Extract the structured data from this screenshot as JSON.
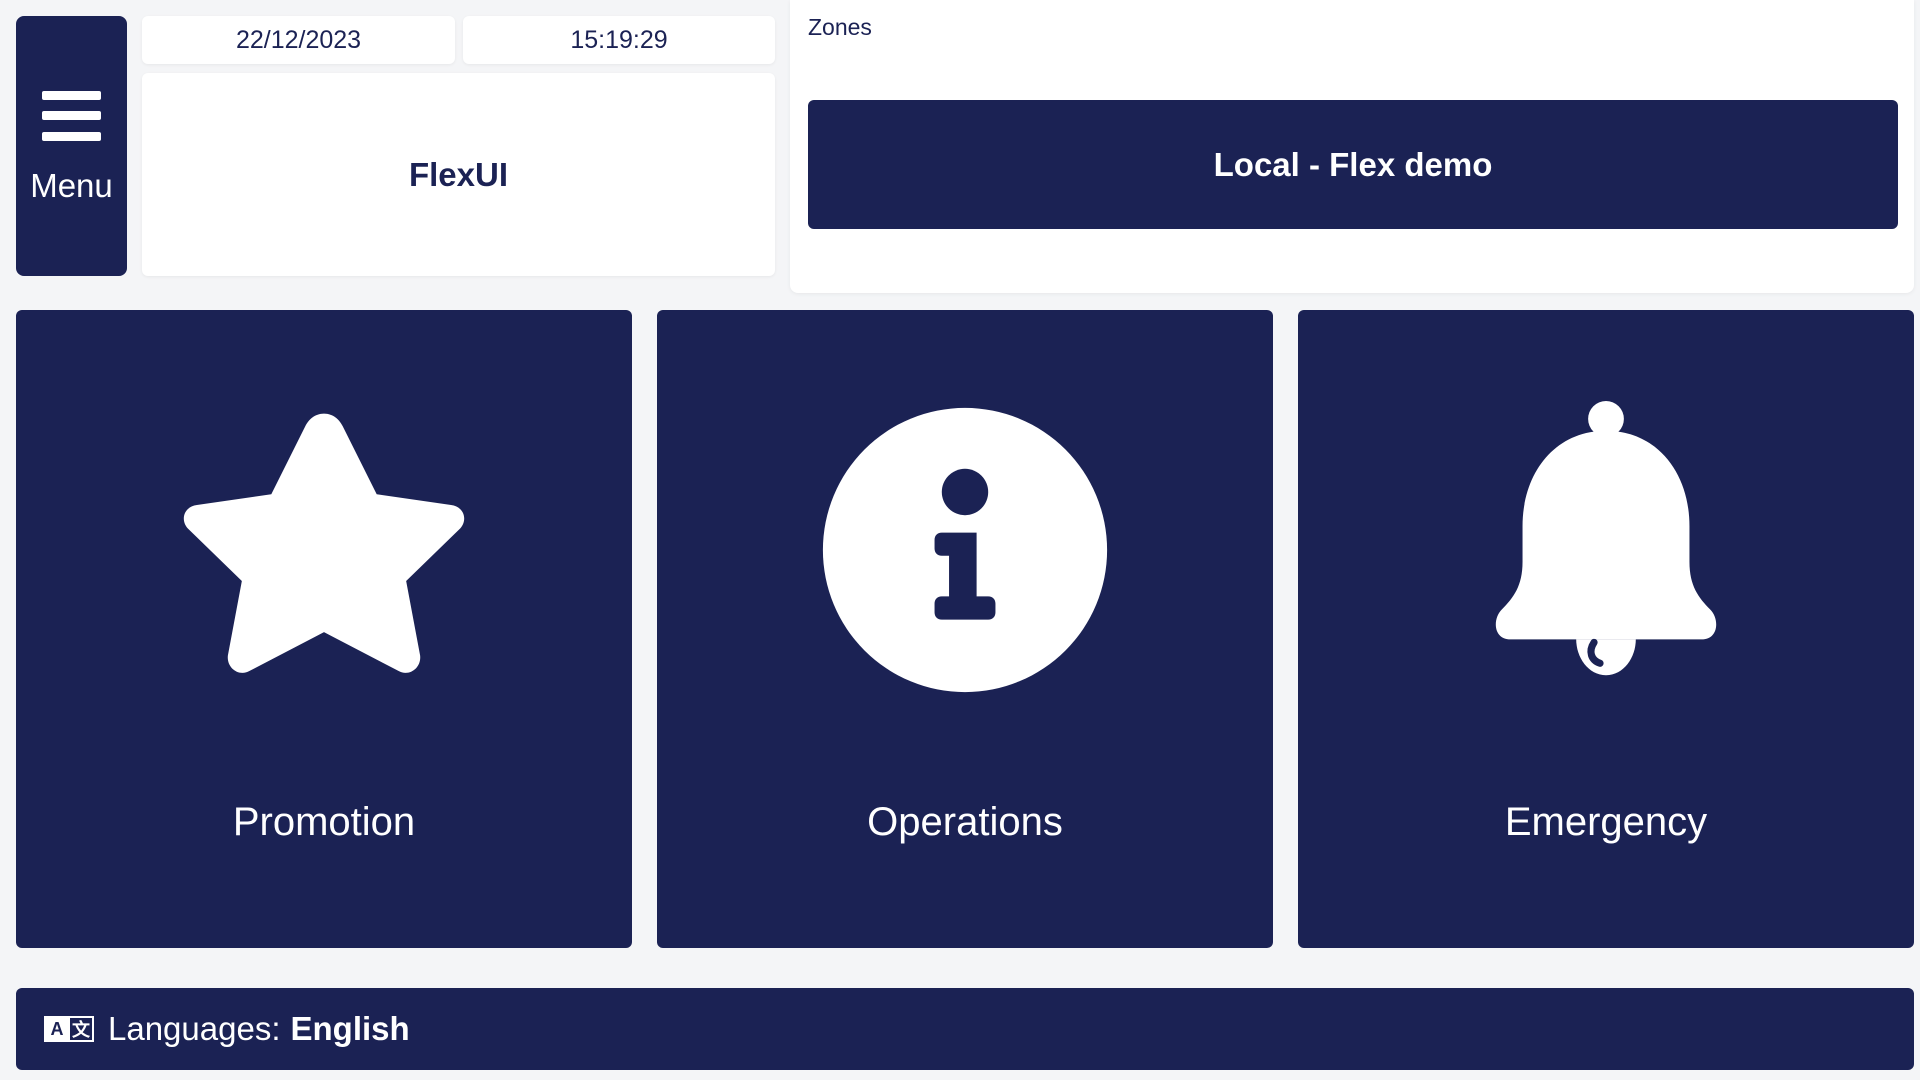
{
  "menu": {
    "label": "Menu",
    "icon": "hamburger-icon"
  },
  "header": {
    "date": "22/12/2023",
    "time": "15:19:29",
    "brand": "FlexUI"
  },
  "zones": {
    "label": "Zones",
    "selected": "Local - Flex demo"
  },
  "tiles": [
    {
      "label": "Promotion",
      "icon": "star-icon"
    },
    {
      "label": "Operations",
      "icon": "info-icon"
    },
    {
      "label": "Emergency",
      "icon": "bell-icon"
    }
  ],
  "language": {
    "prefix": "Languages:",
    "value": "English",
    "icon": "translate-icon"
  },
  "colors": {
    "primary": "#1b2254",
    "background": "#f4f5f7",
    "surface": "#ffffff",
    "on_primary": "#ffffff"
  }
}
